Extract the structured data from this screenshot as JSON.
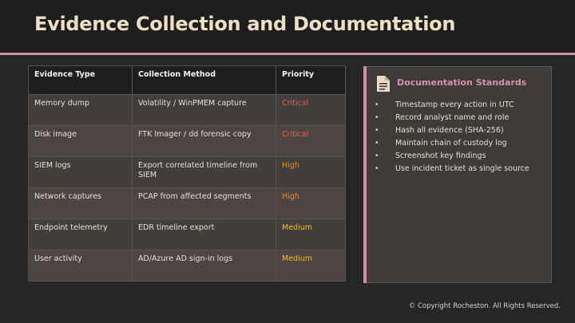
{
  "title": "Evidence Collection and Documentation",
  "table": {
    "headers": [
      "Evidence Type",
      "Collection Method",
      "Priority"
    ],
    "rows": [
      {
        "type": "Memory dump",
        "method": "Volatility / WinPMEM capture",
        "priority": "Critical"
      },
      {
        "type": "Disk image",
        "method": "FTK Imager / dd forensic copy",
        "priority": "Critical"
      },
      {
        "type": "SIEM logs",
        "method": "Export correlated timeline from SIEM",
        "priority": "High"
      },
      {
        "type": "Network captures",
        "method": "PCAP from affected segments",
        "priority": "High"
      },
      {
        "type": "Endpoint telemetry",
        "method": "EDR timeline export",
        "priority": "Medium"
      },
      {
        "type": "User activity",
        "method": "AD/Azure AD sign-in logs",
        "priority": "Medium"
      }
    ]
  },
  "documentation": {
    "icon": "document-icon",
    "title": "Documentation Standards",
    "items": [
      "Timestamp every action in UTC",
      "Record analyst name and role",
      "Hash all evidence (SHA-256)",
      "Maintain chain of custody log",
      "Screenshot key findings",
      "Use incident ticket as single source"
    ]
  },
  "copyright": "© Copyright Rocheston. All Rights Reserved.",
  "colors": {
    "accent": "#cf8ea6",
    "critical": "#ec5d4a",
    "high": "#f08a24",
    "medium": "#f0c02a"
  }
}
